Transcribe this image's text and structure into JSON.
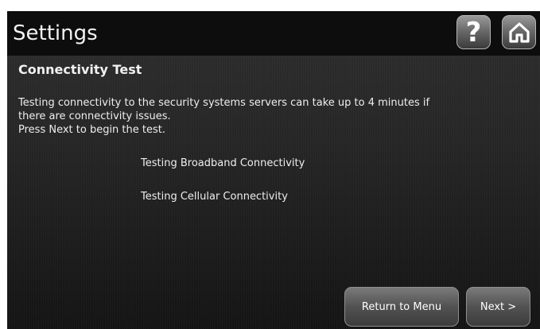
{
  "header": {
    "title": "Settings",
    "help_label": "?"
  },
  "icons": {
    "help": "question-mark-icon",
    "home": "home-icon"
  },
  "main": {
    "heading": "Connectivity Test",
    "description_lines": [
      "Testing connectivity to the security systems servers can take up to 4 minutes if",
      "there are connectivity issues.",
      "Press Next to begin the test."
    ],
    "tests": [
      "Testing Broadband Connectivity",
      "Testing Cellular Connectivity"
    ]
  },
  "footer": {
    "return_label": "Return to Menu",
    "next_label": "Next >"
  },
  "colors": {
    "title_bar": "#0d0d0d",
    "background": "#262626",
    "text": "#eeeeee"
  }
}
